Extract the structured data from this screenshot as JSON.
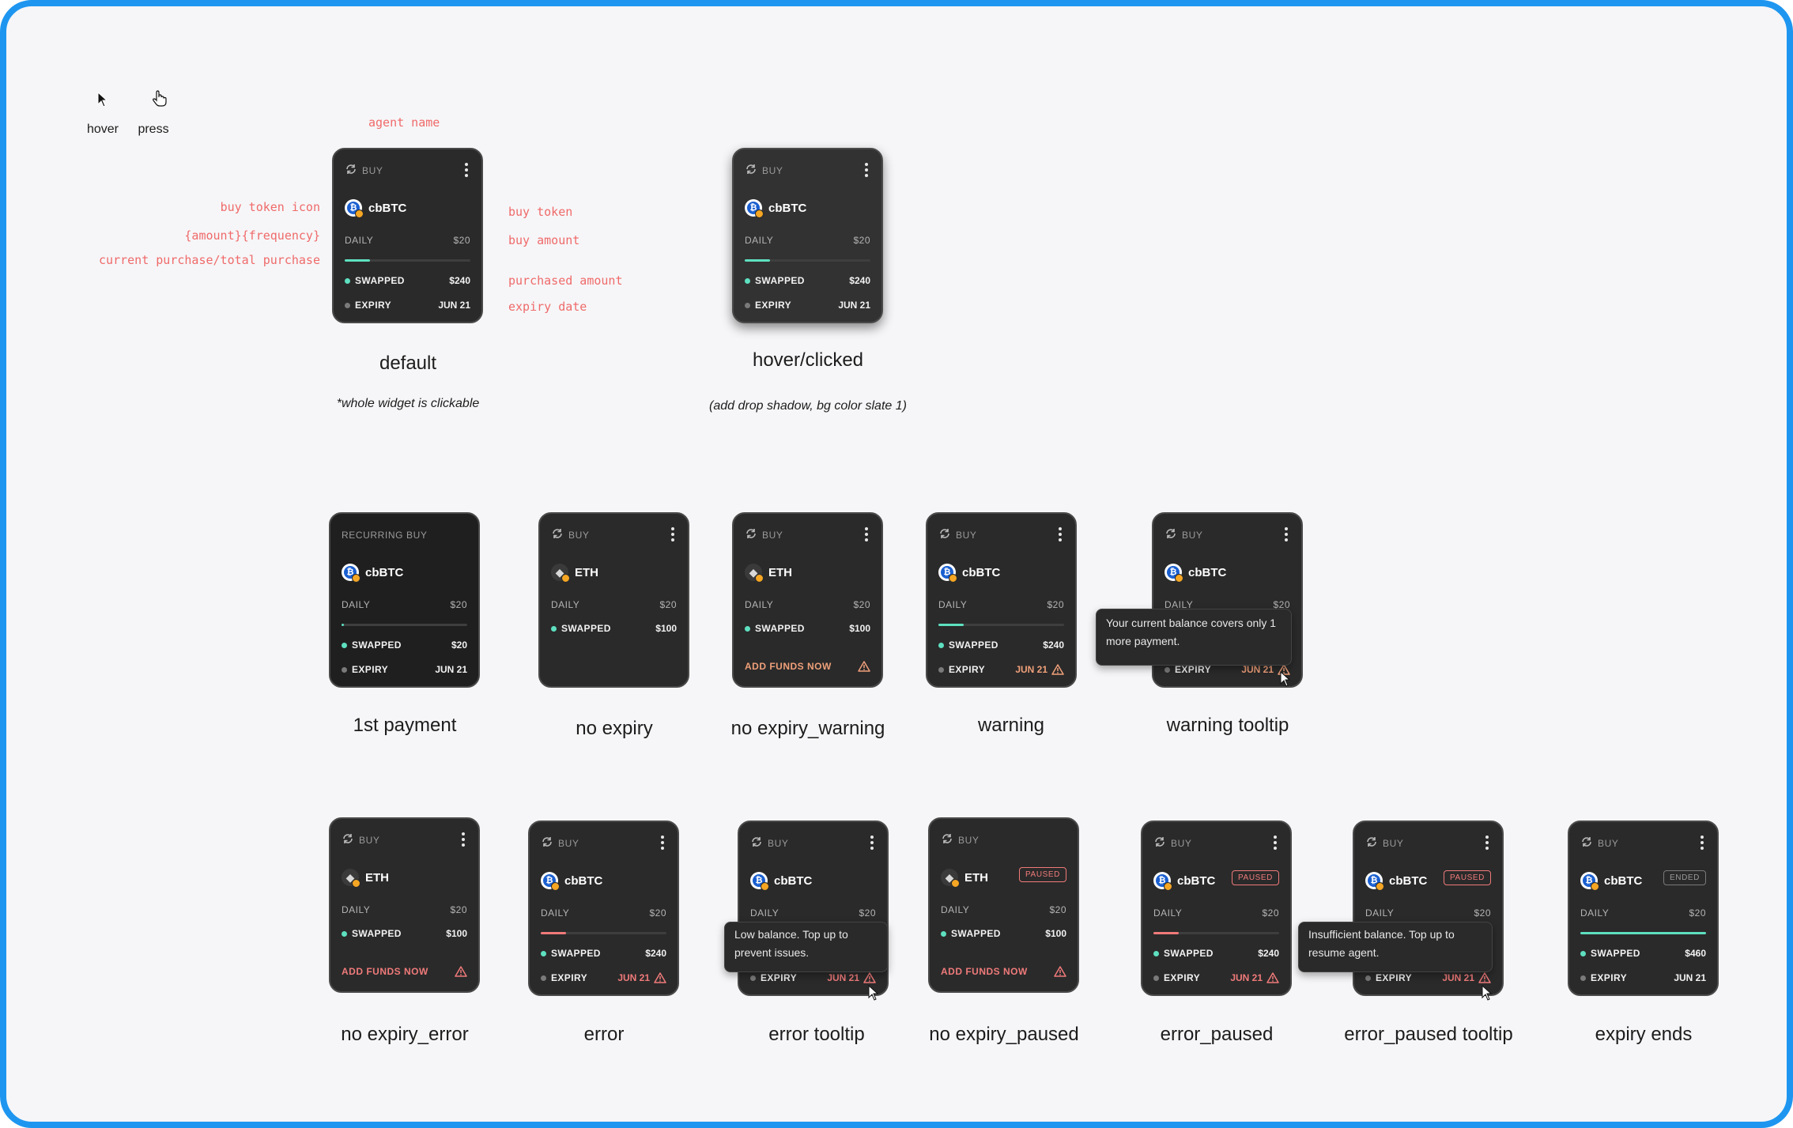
{
  "legend": {
    "hover": "hover",
    "press": "press"
  },
  "annotations": {
    "agent_name": "agent name",
    "buy_token_icon": "buy token icon",
    "amount_frequency": "{amount}{frequency}",
    "progress": "current purchase/total purchase",
    "buy_token": "buy token",
    "buy_amount": "buy amount",
    "purchased_amount": "purchased amount",
    "expiry_date": "expiry date"
  },
  "notes": {
    "default": "*whole widget is clickable",
    "hover": "(add drop shadow, bg color slate 1)"
  },
  "common": {
    "buy": "BUY",
    "recurring_buy": "RECURRING BUY",
    "daily": "DAILY",
    "swapped": "SWAPPED",
    "expiry": "EXPIRY",
    "add_funds": "ADD FUNDS NOW",
    "paused": "PAUSED",
    "ended": "ENDED",
    "cbbtc": "cbBTC",
    "eth": "ETH",
    "amt20": "$20",
    "amt240": "$240",
    "amt100": "$100",
    "amt460": "$460",
    "jun21": "JUN 21"
  },
  "states": {
    "default": "default",
    "hover": "hover/clicked",
    "first": "1st payment",
    "no_expiry": "no expiry",
    "no_expiry_warning": "no expiry_warning",
    "warning": "warning",
    "warning_tooltip": "warning tooltip",
    "no_expiry_error": "no expiry_error",
    "error": "error",
    "error_tooltip": "error tooltip",
    "no_expiry_paused": "no expiry_paused",
    "error_paused": "error_paused",
    "error_paused_tooltip": "error_paused tooltip",
    "expiry_ends": "expiry ends"
  },
  "progress": {
    "default": 0.2,
    "first": 0.02,
    "warning": 0.2,
    "error": 0.2,
    "ended": 1.0
  },
  "tooltips": {
    "warning": "Your current balance covers only 1 more payment.",
    "error": "Low balance. Top up to prevent issues.",
    "error_paused": "Insufficient balance. Top up to resume agent."
  },
  "colors": {
    "accent_green": "#5ee0c0",
    "warning": "#f0a07a",
    "error": "#f07a7a",
    "card_bg": "#2a2a2a",
    "annotation": "#f06a6a",
    "frame": "#1e96f0"
  },
  "icons": {
    "recurring": "recurring-icon",
    "menu": "more-vertical-icon",
    "warning": "warning-triangle-icon",
    "cursor": "arrow-cursor-icon",
    "hand": "hand-pointer-icon"
  }
}
